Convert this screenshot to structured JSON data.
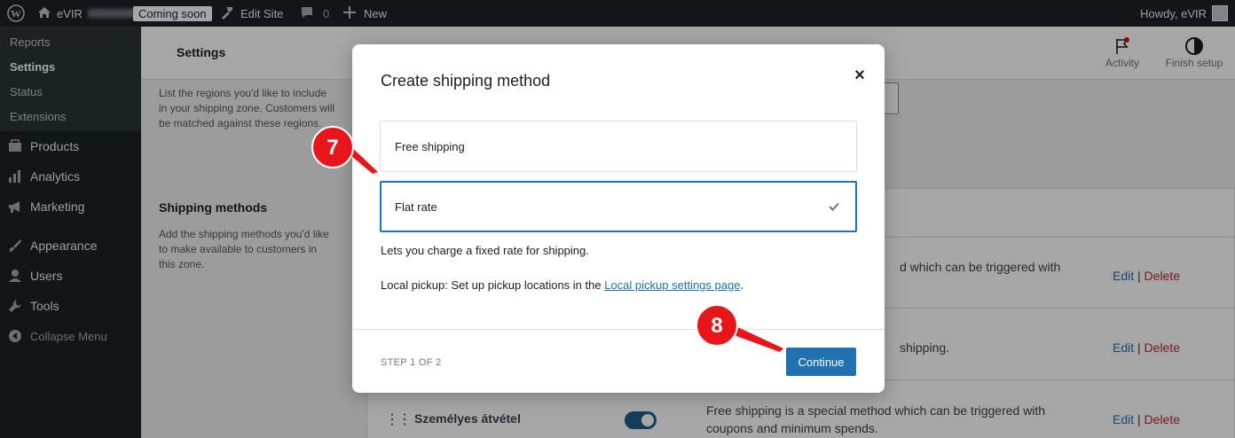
{
  "admin_bar": {
    "site_name": "eVIR",
    "coming_soon": "Coming soon",
    "edit_site": "Edit Site",
    "comments_count": "0",
    "new_label": "New",
    "howdy": "Howdy, eVIR"
  },
  "sidebar": {
    "submenu": [
      {
        "label": "Reports"
      },
      {
        "label": "Settings"
      },
      {
        "label": "Status"
      },
      {
        "label": "Extensions"
      }
    ],
    "menu": [
      {
        "label": "Products",
        "icon": "products-icon"
      },
      {
        "label": "Analytics",
        "icon": "analytics-icon"
      },
      {
        "label": "Marketing",
        "icon": "megaphone-icon"
      },
      {
        "label": "Appearance",
        "icon": "paintbrush-icon"
      },
      {
        "label": "Users",
        "icon": "user-icon"
      },
      {
        "label": "Tools",
        "icon": "wrench-icon"
      },
      {
        "label": "Collapse Menu",
        "icon": "collapse-icon"
      }
    ]
  },
  "header": {
    "title": "Settings",
    "activity": "Activity",
    "finish_setup": "Finish setup"
  },
  "background": {
    "regions_desc": "List the regions you'd like to include in your shipping zone. Customers will be matched against these regions.",
    "methods_title": "Shipping methods",
    "methods_desc": "Add the shipping methods you'd like to make available to customers in this zone.",
    "row1_text": "d which can be triggered with",
    "row2_text": "shipping.",
    "row3_name": "Személyes átvétel",
    "row3_text": "Free shipping is a special method which can be triggered with coupons and minimum spends.",
    "edit": "Edit",
    "delete": "Delete",
    "separator": "|"
  },
  "modal": {
    "title": "Create shipping method",
    "close": "×",
    "options": [
      {
        "label": "Free shipping",
        "selected": false
      },
      {
        "label": "Flat rate",
        "selected": true
      }
    ],
    "selected_desc": "Lets you charge a fixed rate for shipping.",
    "local_prefix": "Local pickup: Set up pickup locations in the ",
    "local_link": "Local pickup settings page",
    "local_suffix": ".",
    "step": "STEP 1 OF 2",
    "continue": "Continue"
  },
  "annotations": {
    "marker_7": "7",
    "marker_8": "8",
    "color": "#e8161b"
  },
  "colors": {
    "admin_bg": "#1d2327",
    "accent": "#2271b1",
    "delete": "#b32d2e"
  }
}
